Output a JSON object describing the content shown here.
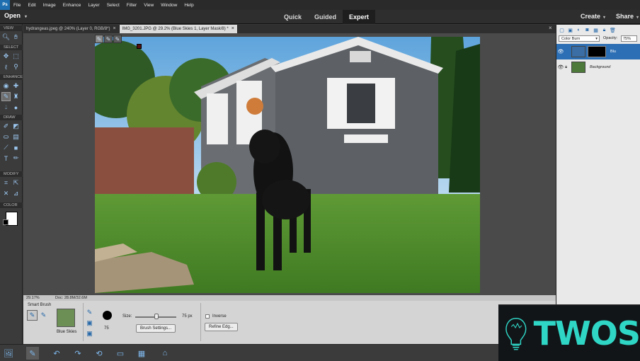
{
  "menubar": {
    "logo": "Ps",
    "items": [
      "File",
      "Edit",
      "Image",
      "Enhance",
      "Layer",
      "Select",
      "Filter",
      "View",
      "Window",
      "Help"
    ]
  },
  "modebar": {
    "open_label": "Open",
    "tabs": [
      "Quick",
      "Guided",
      "Expert"
    ],
    "active_tab": "Expert",
    "create_label": "Create",
    "share_label": "Share"
  },
  "toolbox": {
    "sections": [
      "VIEW",
      "SELECT",
      "ENHANCE",
      "DRAW",
      "MODIFY",
      "COLOR"
    ],
    "colors": {
      "foreground": "#ffffff",
      "background": "#000000"
    }
  },
  "doc_tabs": [
    {
      "label": "hydrangeas.jpeg @ 240% (Layer 0, RGB/8*)",
      "close": "×"
    },
    {
      "label": "IMG_3201.JPG @ 29.2% (Blue Skies 1, Layer Mask/8) *",
      "close": "×"
    }
  ],
  "status": {
    "zoom": "29.17%",
    "doc": "Doc: 28.8M/32.6M"
  },
  "tool_options": {
    "title": "Smart Brush",
    "preset_name": "Blue Skies",
    "brush_size_value": "75",
    "size_label": "Size:",
    "size_value": "75 px",
    "brush_settings": "Brush Settings...",
    "inverse_label": "Inverse",
    "refine_edge": "Refine Edg..."
  },
  "layers": {
    "blend_mode": "Color Burn",
    "opacity_label": "Opacity:",
    "opacity_value": "75%",
    "items": [
      {
        "name": "Blu",
        "selected": true
      },
      {
        "name": "Background",
        "selected": false
      }
    ]
  },
  "watermark": {
    "text": "TWOS"
  },
  "icons": {
    "accent": "#2467a8",
    "taskbar": [
      "photo-bin-icon",
      "tool-options-icon",
      "undo-icon",
      "redo-icon",
      "rotate-icon",
      "layout-icon",
      "organizer-icon",
      "home-screen-icon"
    ]
  }
}
